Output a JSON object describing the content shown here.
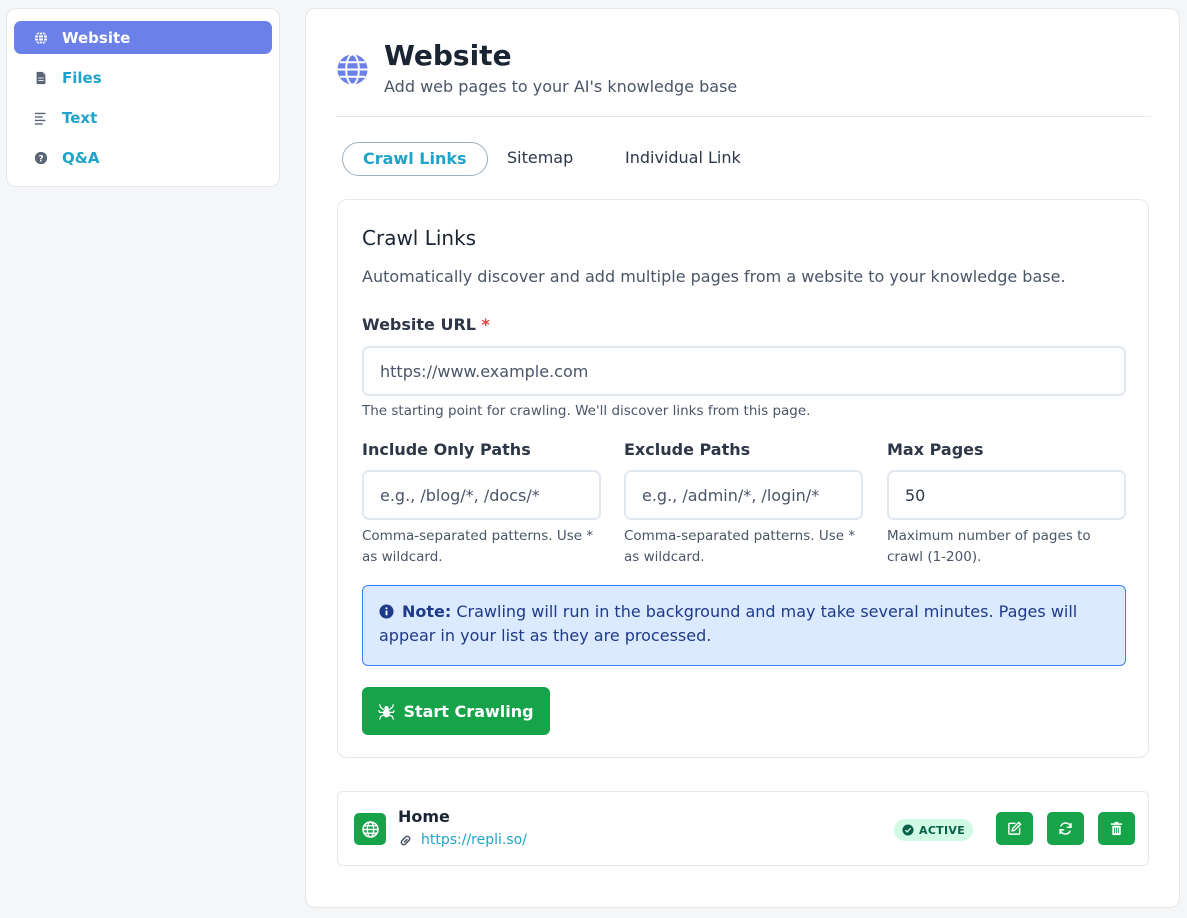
{
  "sidebar": {
    "items": [
      {
        "label": "Website",
        "icon": "globe-icon",
        "active": true
      },
      {
        "label": "Files",
        "icon": "file-icon",
        "active": false
      },
      {
        "label": "Text",
        "icon": "align-left-icon",
        "active": false
      },
      {
        "label": "Q&A",
        "icon": "question-circle-icon",
        "active": false
      }
    ]
  },
  "header": {
    "title": "Website",
    "subtitle": "Add web pages to your AI's knowledge base"
  },
  "tabs": [
    {
      "label": "Crawl Links",
      "active": true
    },
    {
      "label": "Sitemap",
      "active": false
    },
    {
      "label": "Individual Link",
      "active": false
    }
  ],
  "crawl": {
    "title": "Crawl Links",
    "description": "Automatically discover and add multiple pages from a website to your knowledge base.",
    "url_label": "Website URL",
    "url_required_mark": "*",
    "url_placeholder": "https://www.example.com",
    "url_help": "The starting point for crawling. We'll discover links from this page.",
    "include_label": "Include Only Paths",
    "include_placeholder": "e.g., /blog/*, /docs/*",
    "include_help": "Comma-separated patterns. Use * as wildcard.",
    "exclude_label": "Exclude Paths",
    "exclude_placeholder": "e.g., /admin/*, /login/*",
    "exclude_help": "Comma-separated patterns. Use * as wildcard.",
    "max_label": "Max Pages",
    "max_value": "50",
    "max_help": "Maximum number of pages to crawl (1-200).",
    "note_label": "Note:",
    "note_text": "Crawling will run in the background and may take several minutes. Pages will appear in your list as they are processed.",
    "start_button": "Start Crawling"
  },
  "pages": [
    {
      "title": "Home",
      "url": "https://repli.so/",
      "status": "ACTIVE"
    }
  ],
  "colors": {
    "accent": "#1ea4c9",
    "sidebar_active": "#6b80e8",
    "success": "#16a34a",
    "note_bg": "#dbeafe",
    "note_border": "#3b82f6"
  }
}
